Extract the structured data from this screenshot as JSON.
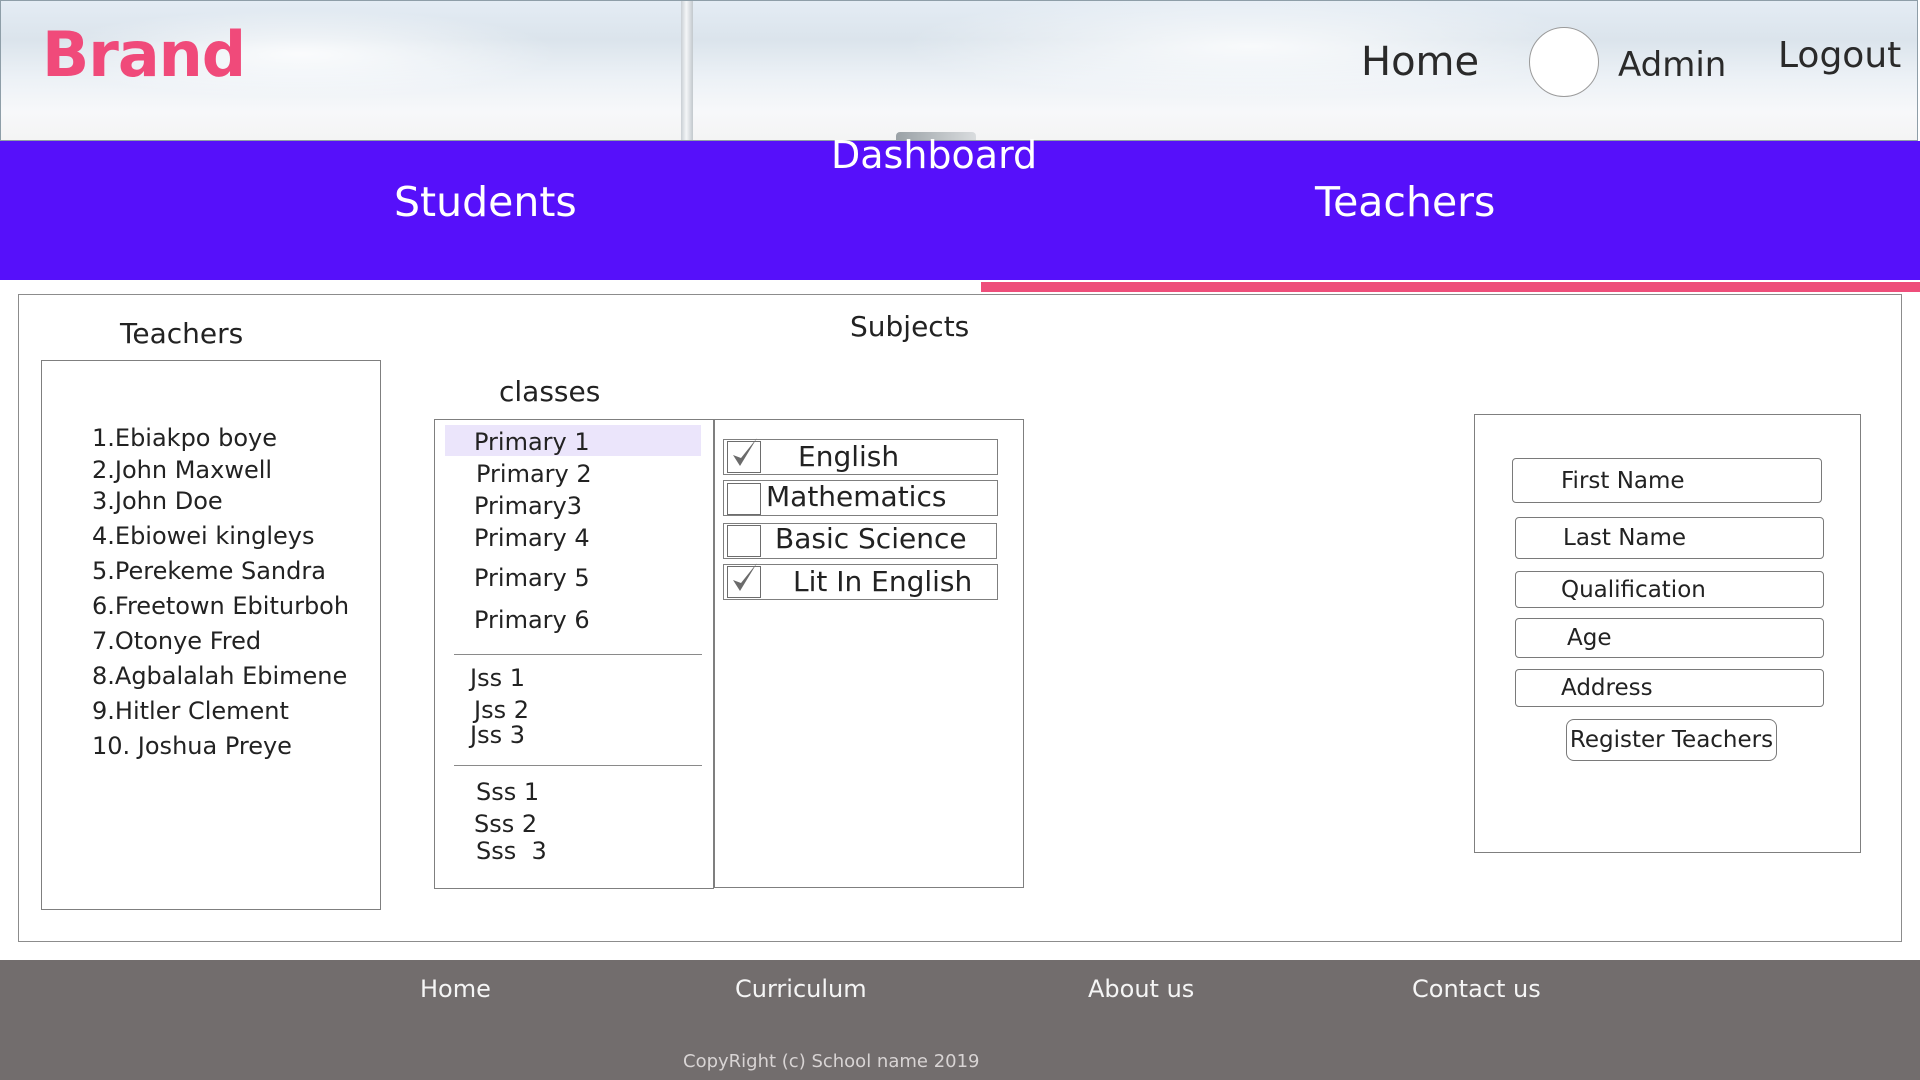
{
  "header": {
    "brand": "Brand",
    "nav": {
      "home": "Home",
      "admin": "Admin",
      "logout": "Logout"
    }
  },
  "tabs": {
    "dashboard": "Dashboard",
    "students": "Students",
    "teachers": "Teachers",
    "active": "Teachers"
  },
  "teachers_panel": {
    "title": "Teachers",
    "items": [
      "1.Ebiakpo boye",
      "2.John Maxwell",
      "3.John Doe",
      "4.Ebiowei kingleys",
      "5.Perekeme Sandra",
      "6.Freetown Ebiturboh",
      "7.Otonye Fred",
      "8.Agbalalah Ebimene",
      "9.Hitler Clement",
      "10. Joshua Preye"
    ]
  },
  "subjects_title": "Subjects",
  "classes_panel": {
    "title": "classes",
    "selected": "Primary 1",
    "primary": [
      "Primary 1",
      "Primary 2",
      "Primary3",
      "Primary 4",
      "Primary 5",
      "Primary 6"
    ],
    "jss": [
      "Jss 1",
      "Jss 2",
      "Jss 3"
    ],
    "sss": [
      "Sss 1",
      "Sss 2",
      "Sss  3"
    ]
  },
  "subjects": [
    {
      "label": "English",
      "checked": true
    },
    {
      "label": "Mathematics",
      "checked": false
    },
    {
      "label": "Basic Science",
      "checked": false
    },
    {
      "label": "Lit In English",
      "checked": true
    }
  ],
  "form": {
    "first_name_placeholder": "First Name",
    "last_name_placeholder": "Last Name",
    "qualification_placeholder": "Qualification",
    "age_placeholder": "Age",
    "address_placeholder": "Address",
    "submit_label": "Register Teachers"
  },
  "footer": {
    "links": [
      "Home",
      "Curriculum",
      "About us",
      "Contact us"
    ],
    "copyright": "CopyRight (c) School name 2019"
  },
  "colors": {
    "brand": "#f04a7a",
    "tab_bar": "#5610fa",
    "active_indicator": "#ee4d7a",
    "footer": "#726d6d",
    "selected_row": "#ebe5fb"
  }
}
